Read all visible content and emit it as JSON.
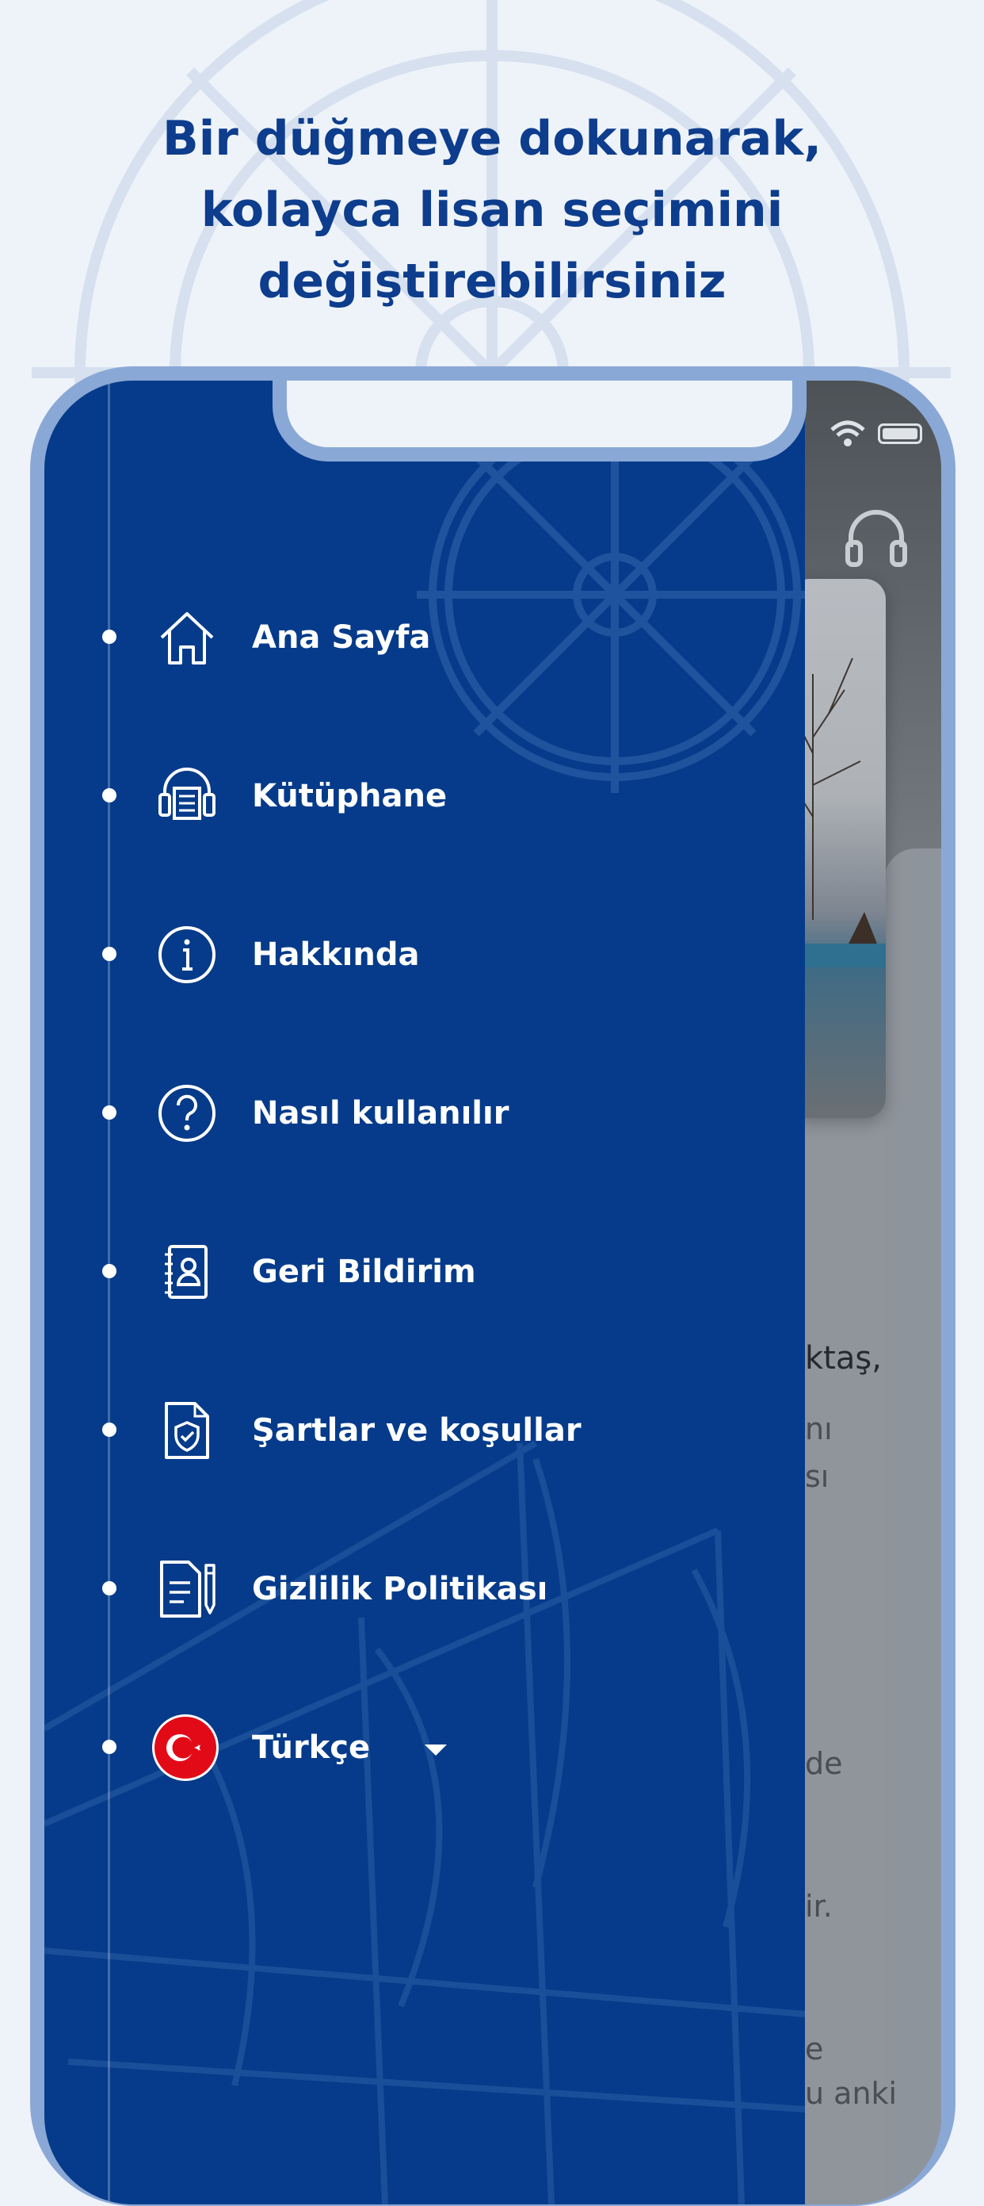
{
  "headline": {
    "line1": "Bir düğmeye dokunarak,",
    "line2": "kolayca lisan seçimini",
    "line3": "değiştirebilirsiniz"
  },
  "menu": {
    "items": [
      {
        "label": "Ana Sayfa",
        "icon": "home-icon"
      },
      {
        "label": "Kütüphane",
        "icon": "audio-library-icon"
      },
      {
        "label": "Hakkında",
        "icon": "info-icon"
      },
      {
        "label": "Nasıl kullanılır",
        "icon": "help-icon"
      },
      {
        "label": "Geri Bildirim",
        "icon": "contact-book-icon"
      },
      {
        "label": "Şartlar ve koşullar",
        "icon": "shield-document-icon"
      },
      {
        "label": "Gizlilik Politikası",
        "icon": "document-pen-icon"
      }
    ],
    "language": {
      "label": "Türkçe",
      "icon": "turkey-flag-icon"
    }
  },
  "background_text": [
    "ktaş,",
    "nı",
    "sı",
    "de",
    "ir.",
    "e",
    "u anki"
  ],
  "colors": {
    "drawer": "#053b8a",
    "headline": "#0d3d8c",
    "page_background": "#eef3fa",
    "phone_frame": "#8aa8d6"
  }
}
